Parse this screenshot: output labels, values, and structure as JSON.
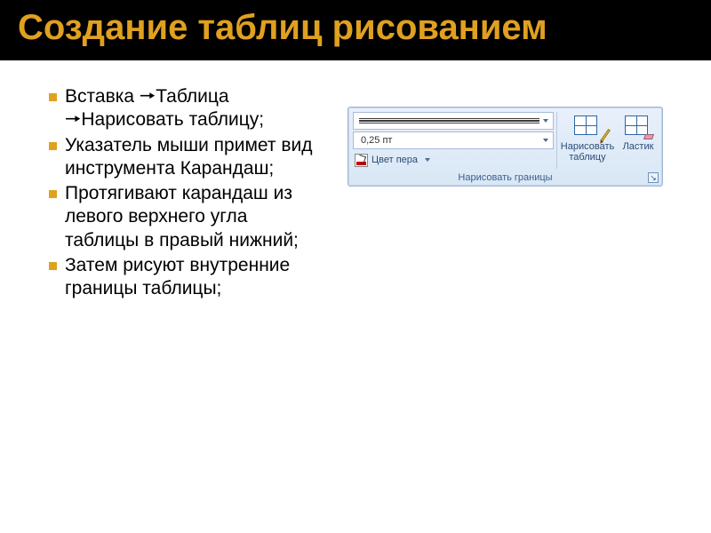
{
  "title": "Создание таблиц рисованием",
  "bullets": [
    "Вставка 🠖Таблица 🠖Нарисовать таблицу;",
    "Указатель мыши примет вид инструмента Карандаш;",
    "Протягивают карандаш из левого верхнего угла таблицы в правый нижний;",
    "Затем рисуют внутренние границы таблицы;"
  ],
  "ribbon": {
    "line_weight": "0,25 пт",
    "pen_color_label": "Цвет пера",
    "draw_table_label": "Нарисовать таблицу",
    "eraser_label": "Ластик",
    "panel_caption": "Нарисовать границы"
  }
}
